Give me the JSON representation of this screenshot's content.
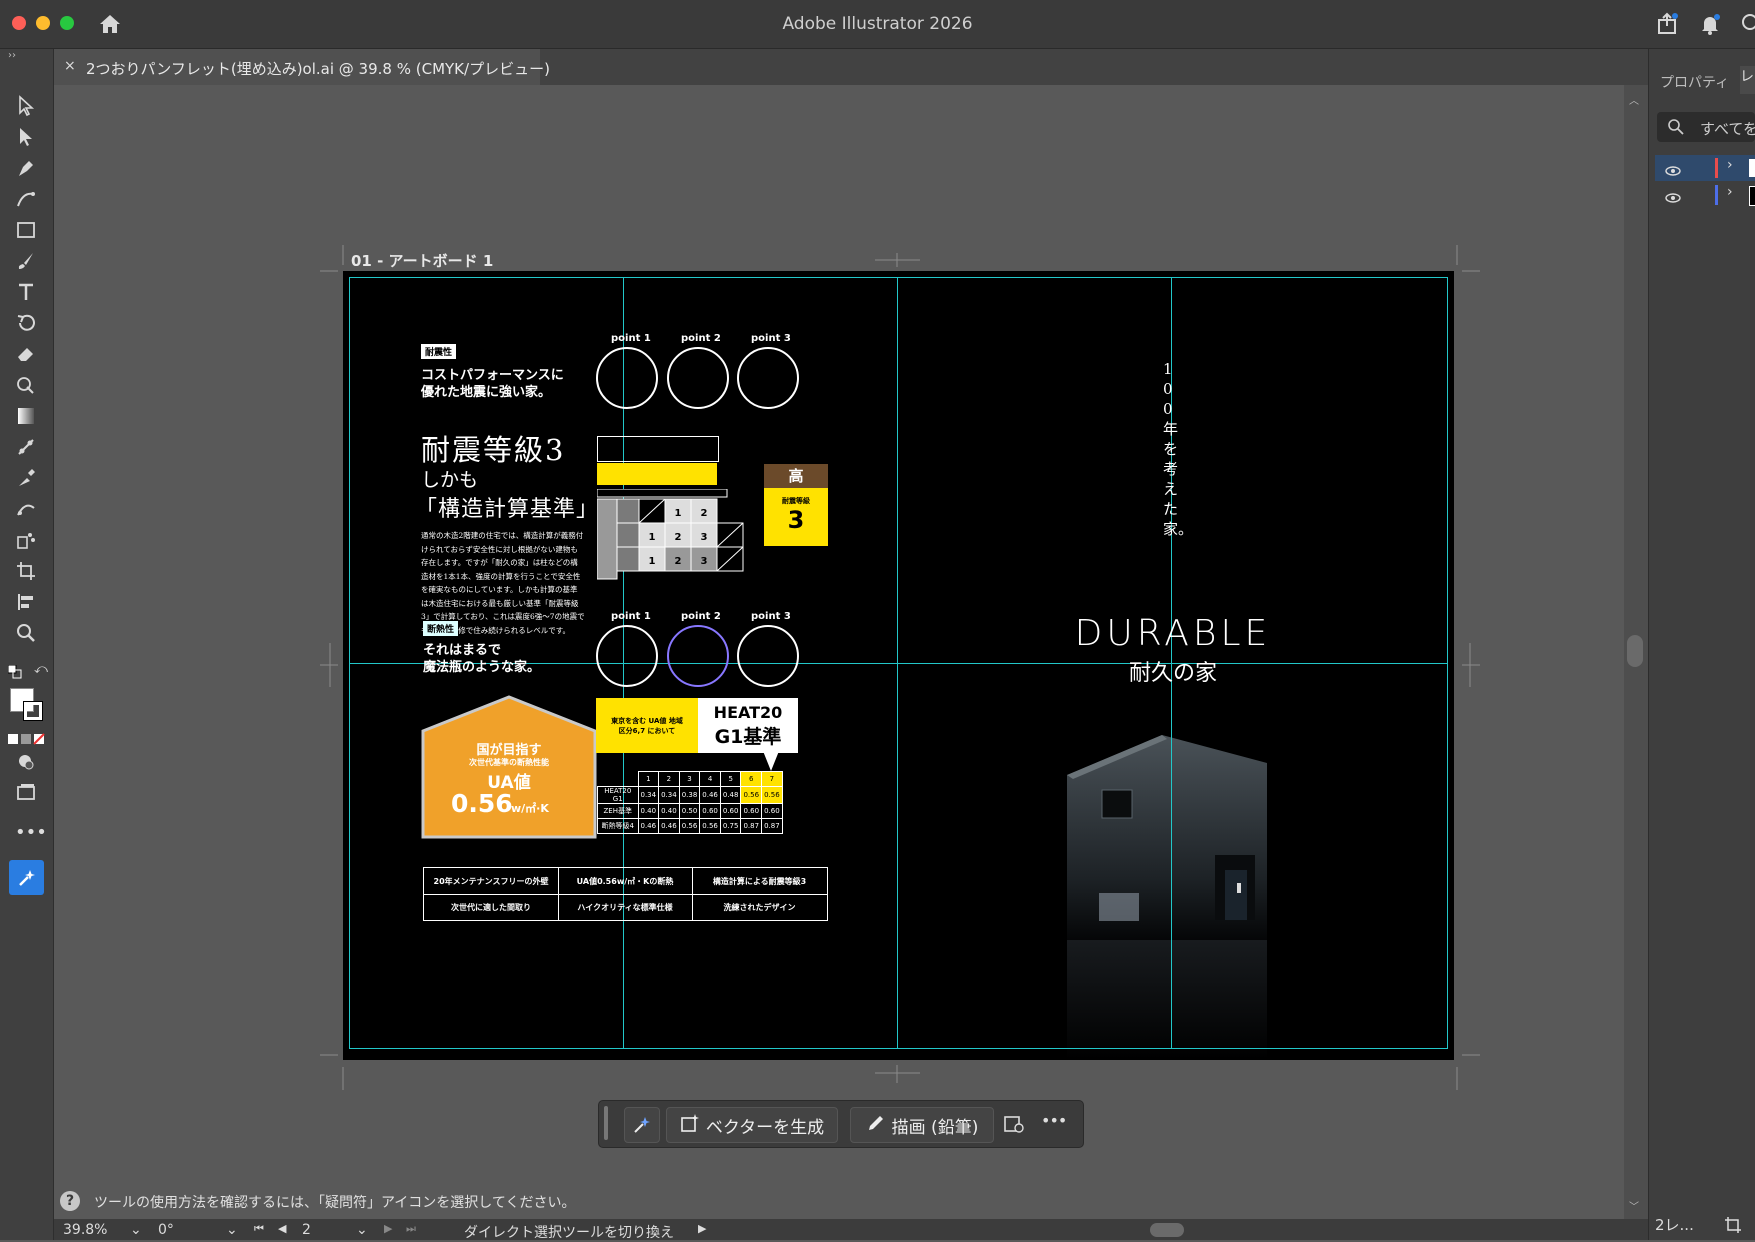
{
  "app": {
    "title": "Adobe Illustrator 2026"
  },
  "document": {
    "tab_close": "×",
    "tab_title": "2つおりパンフレット(埋め込み)ol.ai @ 39.8 % (CMYK/プレビュー)"
  },
  "artboard": {
    "label": "01 - アートボード 1"
  },
  "right_panel": {
    "tab_properties": "プロパティ",
    "tab_layers": "レ",
    "search_placeholder": "すべてを",
    "footer_label": "2レ..."
  },
  "contextual_bar": {
    "generate_vector": "ベクターを生成",
    "draw_pencil": "描画 (鉛筆)"
  },
  "status": {
    "help_message": "ツールの使用方法を確認するには、「疑問符」アイコンを選択してください。"
  },
  "footer": {
    "zoom": "39.8%",
    "rotation": "0°",
    "page": "2",
    "tool_toggle": "ダイレクト選択ツールを切り換え"
  },
  "brochure": {
    "tag1": "耐震性",
    "lead1_line1": "コストパフォーマンスに",
    "lead1_line2": "優れた地震に強い家。",
    "headline_1": "耐震等級3",
    "headline_2": "しかも",
    "headline_3": "「構造計算基準」",
    "body": "通常の木造2階建の住宅では、構造計算が義務付けられておらず安全性に対し根拠がない建物も存在します。ですが「耐久の家」は柱などの構造材を1本1本、強度の計算を行うことで安全性を確実なものにしています。しかも計算の基準は木造住宅における最も厳しい基準「耐震等級3」で計算しており、これは震度6強〜7の地震でも、軽い補修で住み続けられるレベルです。",
    "tag2": "断熱性",
    "lead2_line1": "それはまるで",
    "lead2_line2": "魔法瓶のような家。",
    "house_line1": "国が目指す",
    "house_line2": "次世代基準の断熱性能",
    "house_line3": "UA値",
    "house_value": "0.56",
    "house_unit": "w/㎡·K",
    "points_top": [
      "point 1",
      "point 2",
      "point 3"
    ],
    "points_bottom": [
      "point 1",
      "point 2",
      "point 3"
    ],
    "grade_high": "高",
    "grade_label": "耐震等級",
    "grade_value": "3",
    "heat_yellow": "東京を含む UA値 地域区分6,7 において",
    "heat_title": "HEAT20",
    "heat_sub": "G1基準",
    "table_header": [
      "",
      "1",
      "2",
      "3",
      "4",
      "5",
      "6",
      "7"
    ],
    "table_rows": [
      [
        "HEAT20 G1",
        "0.34",
        "0.34",
        "0.38",
        "0.46",
        "0.48",
        "0.56",
        "0.56"
      ],
      [
        "ZEH基準",
        "0.40",
        "0.40",
        "0.50",
        "0.60",
        "0.60",
        "0.60",
        "0.60"
      ],
      [
        "断熱等級4",
        "0.46",
        "0.46",
        "0.56",
        "0.56",
        "0.75",
        "0.87",
        "0.87"
      ]
    ],
    "features": [
      "20年メンテナンスフリーの外壁",
      "UA値0.56w/㎡・Kの断熱",
      "構造計算による耐震等級3",
      "次世代に適した間取り",
      "ハイクオリティな標準仕様",
      "洗練されたデザイン"
    ],
    "vertical_copy": "100年を考えた家。",
    "durable_en": "DURABLE",
    "durable_jp": "耐久の家"
  },
  "colors": {
    "guide": "#22c7c9",
    "accent_yellow": "#ffe200",
    "house_orange": "#f0a12a",
    "brown": "#6b4a2a",
    "selected_blue": "#2a7de1"
  }
}
